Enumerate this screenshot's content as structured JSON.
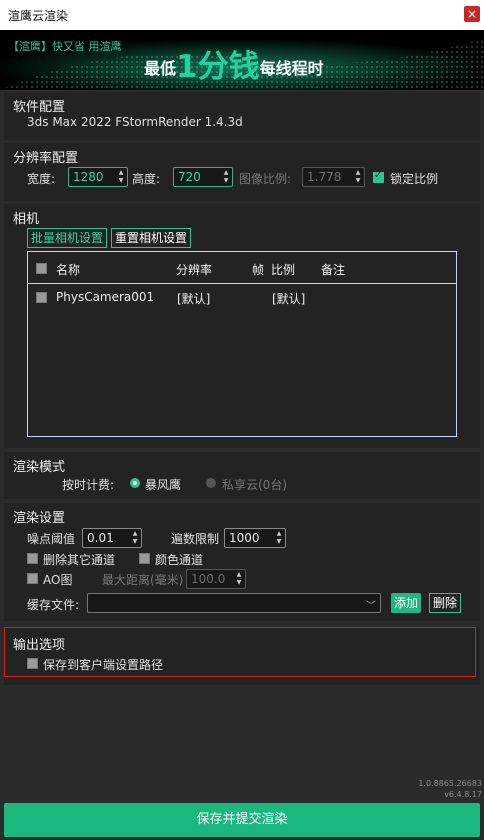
{
  "window": {
    "title": "渲鹰云渲染",
    "close_glyph": "×"
  },
  "banner": {
    "tag": "【渲鹰】快又省 用渲鹰",
    "slogan_pre": "最低",
    "slogan_big": "1分钱",
    "slogan_post": "每线程时",
    "accent_color": "#1fd3a0"
  },
  "software": {
    "heading": "软件配置",
    "value": "3ds Max 2022  FStormRender 1.4.3d"
  },
  "resolution": {
    "heading": "分辨率配置",
    "width_label": "宽度:",
    "width_value": "1280",
    "height_label": "高度:",
    "height_value": "720",
    "ratio_label": "图像比例:",
    "ratio_value": "1.778",
    "lock_label": "锁定比例",
    "lock_checked": true
  },
  "camera": {
    "heading": "相机",
    "batch_button": "批量相机设置",
    "reset_button": "重置相机设置",
    "columns": [
      "名称",
      "分辨率",
      "帧",
      "比例",
      "备注"
    ],
    "rows": [
      {
        "name": "PhysCamera001",
        "resolution": "[默认]",
        "frame": "",
        "ratio": "[默认]",
        "note": ""
      }
    ]
  },
  "render_mode": {
    "heading": "渲染模式",
    "billing_label": "按时计费:",
    "option_a": "暴风鹰",
    "option_b": "私享云(0台)",
    "selected": "暴风鹰"
  },
  "render_settings": {
    "heading": "渲染设置",
    "noise_label": "噪点阈值",
    "noise_value": "0.01",
    "pass_label": "遍数限制",
    "pass_value": "1000",
    "delete_channels_label": "删除其它通道",
    "color_channel_label": "颜色通道",
    "ao_label": "AO图",
    "max_distance_label": "最大距离(毫米)",
    "max_distance_value": "100.0",
    "cache_label": "缓存文件:",
    "cache_value": "",
    "add_button": "添加",
    "delete_button": "删除"
  },
  "output": {
    "heading": "输出选项",
    "save_client_path_label": "保存到客户端设置路径"
  },
  "version": {
    "line1": "1.0.8865.26683",
    "line2": "v6.4.8.17"
  },
  "submit_button": "保存并提交渲染"
}
